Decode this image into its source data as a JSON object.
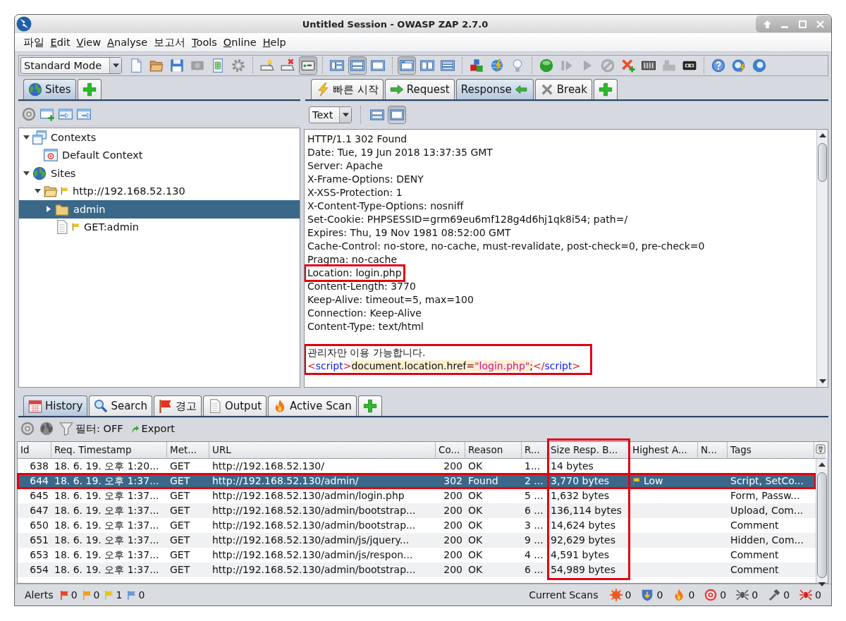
{
  "window": {
    "title": "Untitled Session - OWASP ZAP 2.7.0"
  },
  "menu": [
    {
      "label": "파일",
      "mnemonic": false
    },
    {
      "label": "Edit",
      "mnemonic": true
    },
    {
      "label": "View",
      "mnemonic": true
    },
    {
      "label": "Analyse",
      "mnemonic": true
    },
    {
      "label": "보고서",
      "mnemonic": false
    },
    {
      "label": "Tools",
      "mnemonic": true
    },
    {
      "label": "Online",
      "mnemonic": true
    },
    {
      "label": "Help",
      "mnemonic": true
    }
  ],
  "toolbar": {
    "mode": "Standard Mode",
    "groups": [
      [
        {
          "kind": "new-page",
          "pressed": false,
          "disabled": false
        },
        {
          "kind": "open-folder",
          "pressed": false,
          "disabled": false
        },
        {
          "kind": "floppy",
          "pressed": false,
          "disabled": false
        },
        {
          "kind": "camera",
          "pressed": false,
          "disabled": true
        },
        {
          "kind": "sheet",
          "pressed": false,
          "disabled": false
        },
        {
          "kind": "gear",
          "pressed": false,
          "disabled": false
        }
      ],
      [
        {
          "kind": "screen-bulb",
          "pressed": false,
          "disabled": false
        },
        {
          "kind": "screen-cross",
          "pressed": false,
          "disabled": false
        },
        {
          "kind": "screen-green",
          "pressed": true,
          "disabled": false
        }
      ],
      [
        {
          "kind": "layout-left",
          "pressed": false,
          "disabled": false
        },
        {
          "kind": "layout-bottom",
          "pressed": true,
          "disabled": false
        },
        {
          "kind": "layout-full",
          "pressed": false,
          "disabled": false
        }
      ],
      [
        {
          "kind": "layout-tabs",
          "pressed": true,
          "disabled": false
        },
        {
          "kind": "layout-columns",
          "pressed": false,
          "disabled": false
        },
        {
          "kind": "layout-rows",
          "pressed": false,
          "disabled": false
        }
      ],
      [
        {
          "kind": "blocks",
          "pressed": false,
          "disabled": false
        },
        {
          "kind": "globe-bolt",
          "pressed": false,
          "disabled": false
        },
        {
          "kind": "bulb",
          "pressed": false,
          "disabled": false
        }
      ],
      [
        {
          "kind": "green-dot",
          "pressed": false,
          "disabled": false
        },
        {
          "kind": "step",
          "pressed": false,
          "disabled": true
        },
        {
          "kind": "play",
          "pressed": false,
          "disabled": true
        },
        {
          "kind": "stop",
          "pressed": false,
          "disabled": true
        },
        {
          "kind": "cross-plus",
          "pressed": false,
          "disabled": false
        },
        {
          "kind": "mixer",
          "pressed": false,
          "disabled": false
        },
        {
          "kind": "tools",
          "pressed": false,
          "disabled": true
        },
        {
          "kind": "tape",
          "pressed": false,
          "disabled": false
        }
      ],
      [
        {
          "kind": "help",
          "pressed": false,
          "disabled": false
        },
        {
          "kind": "globe-bolt-blue",
          "pressed": false,
          "disabled": false
        },
        {
          "kind": "globe-blue",
          "pressed": false,
          "disabled": false
        }
      ]
    ]
  },
  "sites_panel": {
    "tabs": [
      {
        "kind": "globe",
        "label": "Sites",
        "selected": true
      },
      {
        "kind": "add",
        "selected": false
      }
    ],
    "tree": [
      {
        "kind": "contexts",
        "label": "Contexts",
        "expanded": true,
        "selected": false,
        "flag": false,
        "children": [
          {
            "kind": "context",
            "label": "Default Context",
            "selected": false,
            "flag": false
          }
        ]
      },
      {
        "kind": "sites",
        "label": "Sites",
        "expanded": true,
        "selected": false,
        "flag": false,
        "children": [
          {
            "kind": "folder",
            "label": "http://192.168.52.130",
            "expanded": true,
            "selected": false,
            "flag": true,
            "children": [
              {
                "kind": "folder",
                "label": "admin",
                "expanded": false,
                "selected": true,
                "flag": false
              },
              {
                "kind": "page",
                "label": "GET:admin",
                "selected": false,
                "flag": true
              }
            ]
          }
        ]
      }
    ]
  },
  "work_panel": {
    "tabs": [
      {
        "kind": "bolt",
        "label": "빠른 시작",
        "selected": false
      },
      {
        "kind": "arrow-right",
        "label": "Request",
        "selected": false
      },
      {
        "kind": "arrow-left",
        "label": "Response",
        "selected": true
      },
      {
        "kind": "cross",
        "label": "Break",
        "selected": false
      },
      {
        "kind": "add",
        "selected": false
      }
    ],
    "view_mode": "Text",
    "layouts": [
      {
        "pressed": false
      },
      {
        "pressed": true
      }
    ],
    "headers": [
      {
        "text": "HTTP/1.1 302 Found",
        "highlighted": false
      },
      {
        "text": "Date: Tue, 19 Jun 2018 13:37:35 GMT",
        "highlighted": false
      },
      {
        "text": "Server: Apache",
        "highlighted": false
      },
      {
        "text": "X-Frame-Options: DENY",
        "highlighted": false
      },
      {
        "text": "X-XSS-Protection: 1",
        "highlighted": false
      },
      {
        "text": "X-Content-Type-Options: nosniff",
        "highlighted": false
      },
      {
        "text": "Set-Cookie: PHPSESSID=grm69eu6mf128g4d6hj1qk8i54; path=/",
        "highlighted": false
      },
      {
        "text": "Expires: Thu, 19 Nov 1981 08:52:00 GMT",
        "highlighted": false
      },
      {
        "text": "Cache-Control: no-store, no-cache, must-revalidate, post-check=0, pre-check=0",
        "highlighted": false
      },
      {
        "text": "Pragma: no-cache",
        "highlighted": false
      },
      {
        "text": "Location: login.php",
        "highlighted": true
      },
      {
        "text": "Content-Length: 3770",
        "highlighted": false
      },
      {
        "text": "Keep-Alive: timeout=5, max=100",
        "highlighted": false
      },
      {
        "text": "Connection: Keep-Alive",
        "highlighted": false
      },
      {
        "text": "Content-Type: text/html",
        "highlighted": false
      }
    ],
    "body": {
      "highlighted": true,
      "lines": [
        {
          "tokens": [
            {
              "kind": "text",
              "text": "관리자만 이용 가능합니다."
            }
          ]
        },
        {
          "tokens": [
            {
              "kind": "bracket",
              "text": "<"
            },
            {
              "kind": "tag",
              "text": "script"
            },
            {
              "kind": "bracket",
              "text": ">"
            },
            {
              "kind": "code",
              "text": "document.location.href"
            },
            {
              "kind": "operator",
              "text": "="
            },
            {
              "kind": "string",
              "text": "\"login.php\""
            },
            {
              "kind": "code",
              "text": ";"
            },
            {
              "kind": "bracket",
              "text": "</"
            },
            {
              "kind": "tag",
              "text": "script"
            },
            {
              "kind": "bracket",
              "text": ">"
            }
          ]
        }
      ]
    }
  },
  "bottom_panel": {
    "tabs": [
      {
        "kind": "calendar",
        "label": "History",
        "selected": true
      },
      {
        "kind": "search",
        "label": "Search",
        "selected": false
      },
      {
        "kind": "flag",
        "label": "경고",
        "selected": false
      },
      {
        "kind": "page",
        "label": "Output",
        "selected": false
      },
      {
        "kind": "flame",
        "label": "Active Scan",
        "selected": false
      },
      {
        "kind": "add",
        "selected": false
      }
    ],
    "filter": "필터: OFF",
    "export": "Export",
    "history": {
      "columns": [
        {
          "label": "Id",
          "highlighted": false
        },
        {
          "label": "Req. Timestamp",
          "highlighted": false
        },
        {
          "label": "Met...",
          "highlighted": false
        },
        {
          "label": "URL",
          "highlighted": false
        },
        {
          "label": "Co...",
          "highlighted": false
        },
        {
          "label": "Reason",
          "highlighted": false
        },
        {
          "label": "R...",
          "highlighted": false
        },
        {
          "label": "Size Resp. B...",
          "highlighted": true
        },
        {
          "label": "Highest A...",
          "highlighted": false
        },
        {
          "label": "N...",
          "highlighted": false
        },
        {
          "label": "Tags",
          "highlighted": false
        }
      ],
      "rows": [
        {
          "selected": false,
          "highlighted": false,
          "alert_flag": false,
          "id": "638",
          "req_timestamp": "18. 6. 19. 오후 1:20...",
          "column_3": "GET",
          "url": "http://192.168.52.130/",
          "column_5": "200",
          "reason": "OK",
          "column_7": "1...",
          "column_8": "14 bytes"
        },
        {
          "selected": true,
          "highlighted": true,
          "alert_flag": true,
          "id": "644",
          "req_timestamp": "18. 6. 19. 오후 1:37...",
          "column_3": "GET",
          "url": "http://192.168.52.130/admin/",
          "column_5": "302",
          "reason": "Found",
          "column_7": "2 ...",
          "column_8": "3,770 bytes",
          "column_9": "Low",
          "tags": "Script, SetCo..."
        },
        {
          "selected": false,
          "highlighted": false,
          "alert_flag": false,
          "id": "645",
          "req_timestamp": "18. 6. 19. 오후 1:37...",
          "column_3": "GET",
          "url": "http://192.168.52.130/admin/login.php",
          "column_5": "200",
          "reason": "OK",
          "column_7": "5 ...",
          "column_8": "1,632 bytes",
          "tags": "Form, Passw..."
        },
        {
          "selected": false,
          "highlighted": false,
          "alert_flag": false,
          "id": "647",
          "req_timestamp": "18. 6. 19. 오후 1:37...",
          "column_3": "GET",
          "url": "http://192.168.52.130/admin/bootstrap...",
          "column_5": "200",
          "reason": "OK",
          "column_7": "6 ...",
          "column_8": "136,114 bytes",
          "tags": "Upload, Com..."
        },
        {
          "selected": false,
          "highlighted": false,
          "alert_flag": false,
          "id": "650",
          "req_timestamp": "18. 6. 19. 오후 1:37...",
          "column_3": "GET",
          "url": "http://192.168.52.130/admin/bootstrap...",
          "column_5": "200",
          "reason": "OK",
          "column_7": "3 ...",
          "column_8": "14,624 bytes",
          "tags": "Comment"
        },
        {
          "selected": false,
          "highlighted": false,
          "alert_flag": false,
          "id": "651",
          "req_timestamp": "18. 6. 19. 오후 1:37...",
          "column_3": "GET",
          "url": "http://192.168.52.130/admin/js/jquery...",
          "column_5": "200",
          "reason": "OK",
          "column_7": "9 ...",
          "column_8": "92,629 bytes",
          "tags": "Hidden, Com..."
        },
        {
          "selected": false,
          "highlighted": false,
          "alert_flag": false,
          "id": "653",
          "req_timestamp": "18. 6. 19. 오후 1:37...",
          "column_3": "GET",
          "url": "http://192.168.52.130/admin/js/respon...",
          "column_5": "200",
          "reason": "OK",
          "column_7": "4 ...",
          "column_8": "4,591 bytes",
          "tags": "Comment"
        },
        {
          "selected": false,
          "highlighted": false,
          "alert_flag": false,
          "id": "654",
          "req_timestamp": "18. 6. 19. 오후 1:37...",
          "column_3": "GET",
          "url": "http://192.168.52.130/admin/bootstrap...",
          "column_5": "200",
          "reason": "OK",
          "column_7": "6 ...",
          "column_8": "54,989 bytes",
          "tags": "Comment"
        }
      ]
    }
  },
  "status_bar": {
    "alerts_label": "Alerts",
    "alerts": [
      {
        "color": "#e8462a",
        "count": "0"
      },
      {
        "color": "#f0a020",
        "count": "0"
      },
      {
        "color": "#e6c21e",
        "count": "1"
      },
      {
        "color": "#6c9ad6",
        "count": "0"
      }
    ],
    "scans_label": "Current Scans",
    "scans": [
      {
        "kind": "burst",
        "count": "0"
      },
      {
        "kind": "shield",
        "count": "0"
      },
      {
        "kind": "flame",
        "count": "0"
      },
      {
        "kind": "target",
        "count": "0"
      },
      {
        "kind": "spider",
        "count": "0"
      },
      {
        "kind": "hammer",
        "count": "0"
      },
      {
        "kind": "bug",
        "count": "0"
      }
    ]
  }
}
